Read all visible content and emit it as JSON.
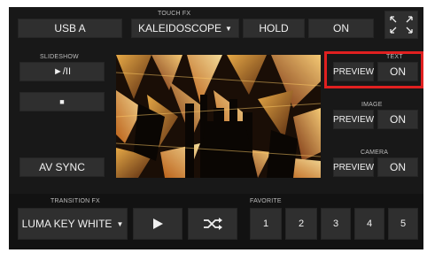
{
  "top": {
    "source_label": "USB A",
    "touch_fx_heading": "TOUCH FX",
    "touch_fx_value": "KALEIDOSCOPE",
    "hold_label": "HOLD",
    "on_label": "ON",
    "expand_icon": "expand-arrows-icon"
  },
  "left": {
    "slideshow_heading": "SLIDESHOW",
    "play_pause_label": "►/II",
    "stop_label": "■",
    "av_sync_label": "AV SYNC"
  },
  "right": {
    "text_heading": "TEXT",
    "image_heading": "IMAGE",
    "camera_heading": "CAMERA",
    "preview_label": "PREVIEW",
    "on_label": "ON"
  },
  "bottom": {
    "transition_heading": "TRANSITION FX",
    "transition_value": "LUMA KEY WHITE",
    "play_icon": "play-icon",
    "shuffle_icon": "shuffle-icon",
    "favorite_heading": "FAVORITE",
    "favorites": [
      "1",
      "2",
      "3",
      "4",
      "5"
    ]
  },
  "colors": {
    "background": "#181818",
    "button": "#2f2f2f",
    "highlight": "#e02020",
    "artwork_accent": "#d98a2a"
  }
}
